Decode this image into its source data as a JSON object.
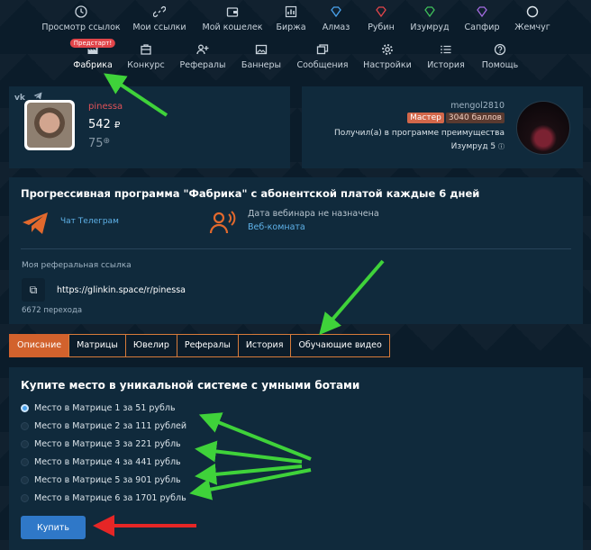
{
  "nav_row1": [
    {
      "label": "Просмотр ссылок",
      "icon": "clock-icon"
    },
    {
      "label": "Мои ссылки",
      "icon": "link-icon"
    },
    {
      "label": "Мой кошелек",
      "icon": "wallet-icon"
    },
    {
      "label": "Биржа",
      "icon": "chart-icon"
    },
    {
      "label": "Алмаз",
      "icon": "diamond-icon"
    },
    {
      "label": "Рубин",
      "icon": "ruby-icon"
    },
    {
      "label": "Изумруд",
      "icon": "emerald-icon"
    },
    {
      "label": "Сапфир",
      "icon": "sapphire-icon"
    },
    {
      "label": "Жемчуг",
      "icon": "pearl-icon"
    }
  ],
  "nav_row2": [
    {
      "label": "Фабрика",
      "icon": "factory-icon",
      "badge": "Предстарт!"
    },
    {
      "label": "Конкурс",
      "icon": "contest-icon"
    },
    {
      "label": "Рефералы",
      "icon": "user-plus-icon"
    },
    {
      "label": "Баннеры",
      "icon": "image-icon"
    },
    {
      "label": "Сообщения",
      "icon": "messages-icon"
    },
    {
      "label": "Настройки",
      "icon": "gear-icon"
    },
    {
      "label": "История",
      "icon": "list-icon"
    },
    {
      "label": "Помощь",
      "icon": "help-icon"
    }
  ],
  "user": {
    "social1": "vk",
    "name": "pinessa",
    "balance": "542",
    "currency": "₽",
    "points": "75"
  },
  "mentor": {
    "name": "mengol2810",
    "level": "Мастер",
    "score": "3040 баллов",
    "program": "Получил(а) в программе преимущества",
    "gem": "Изумруд 5"
  },
  "program": {
    "title": "Прогрессивная программа \"Фабрика\" с абонентской платой каждые 6 дней",
    "telegram": "Чат Телеграм",
    "webinar_date": "Дата вебинара не назначена",
    "webinar_room": "Веб-комната",
    "ref_label": "Моя реферальная ссылка",
    "ref_link": "https://glinkin.space/r/pinessa",
    "ref_count": "6672 перехода"
  },
  "tabs": [
    "Описание",
    "Матрицы",
    "Ювелир",
    "Рефералы",
    "История",
    "Обучающие видео"
  ],
  "buy": {
    "title": "Купите место в уникальной системе с умными ботами",
    "options": [
      "Место в Матрице 1 за 51 рубль",
      "Место в Матрице 2 за 111 рублей",
      "Место в Матрице 3 за 221 рубль",
      "Место в Матрице 4 за 441 рубль",
      "Место в Матрице 5 за 901 рубль",
      "Место в Матрице 6 за 1701 рубль"
    ],
    "selected": 0,
    "button": "Купить"
  },
  "colors": {
    "background": "#0b1c2a",
    "card": "#102a3c",
    "accent_orange": "#d2622d",
    "link_blue": "#5fb2e9",
    "button_blue": "#2f78c8",
    "annotation_green": "#3fd23a",
    "annotation_red": "#e62626"
  }
}
